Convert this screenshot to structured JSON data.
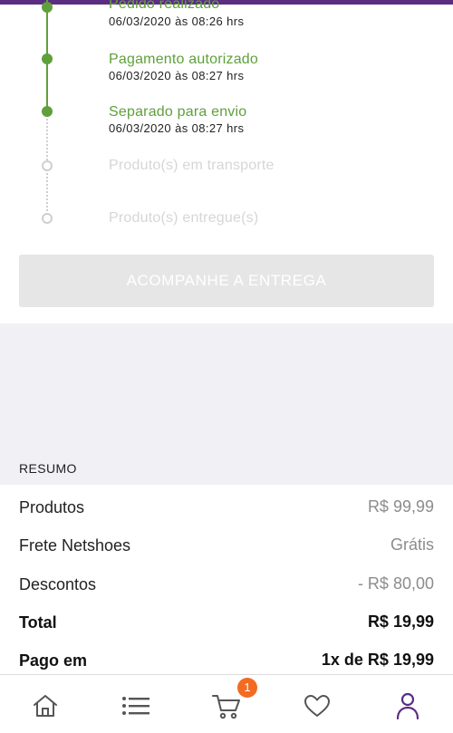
{
  "timeline": {
    "steps": [
      {
        "title": "Pedido realizado",
        "date": "06/03/2020 às 08:26 hrs",
        "status": "done"
      },
      {
        "title": "Pagamento autorizado",
        "date": "06/03/2020 às 08:27 hrs",
        "status": "done"
      },
      {
        "title": "Separado para envio",
        "date": "06/03/2020 às 08:27 hrs",
        "status": "done"
      },
      {
        "title": "Produto(s) em transporte",
        "status": "pending"
      },
      {
        "title": "Produto(s) entregue(s)",
        "status": "pending"
      }
    ]
  },
  "track_button": {
    "label": "ACOMPANHE A ENTREGA"
  },
  "summary": {
    "heading": "RESUMO",
    "rows": [
      {
        "label": "Produtos",
        "value": "R$ 99,99"
      },
      {
        "label": "Frete Netshoes",
        "value": "Grátis"
      },
      {
        "label": "Descontos",
        "value": "- R$ 80,00"
      },
      {
        "label": "Total",
        "value": "R$ 19,99"
      },
      {
        "label": "Pago em",
        "value": "1x de R$ 19,99"
      }
    ]
  },
  "bottom_nav": {
    "items": [
      {
        "icon": "home-icon"
      },
      {
        "icon": "list-icon"
      },
      {
        "icon": "cart-icon"
      },
      {
        "icon": "heart-icon"
      },
      {
        "icon": "user-icon"
      }
    ],
    "cart_badge": "1"
  },
  "colors": {
    "brand": "#5a2d82",
    "done": "#5fa03b",
    "pending": "#cfcfcf",
    "badge": "#f26b21"
  }
}
